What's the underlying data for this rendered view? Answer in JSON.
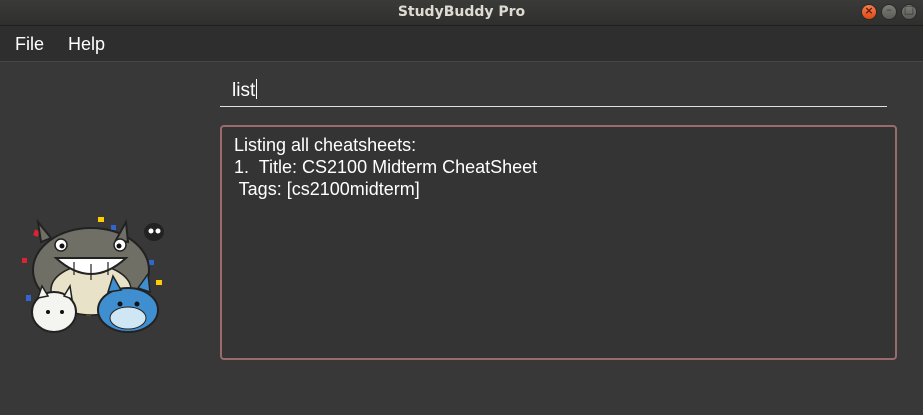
{
  "window": {
    "title": "StudyBuddy Pro"
  },
  "menu": {
    "items": [
      "File",
      "Help"
    ]
  },
  "command": {
    "value": "list"
  },
  "result": {
    "lines": [
      "Listing all cheatsheets:",
      "1.  Title: CS2100 Midterm CheatSheet",
      " Tags: [cs2100midterm]"
    ]
  },
  "colors": {
    "background": "#383838",
    "result_border": "#9b6a6a",
    "close_button": "#e8581f"
  },
  "icons": [
    "close-icon",
    "minimize-icon",
    "maximize-icon",
    "mascot-image"
  ]
}
